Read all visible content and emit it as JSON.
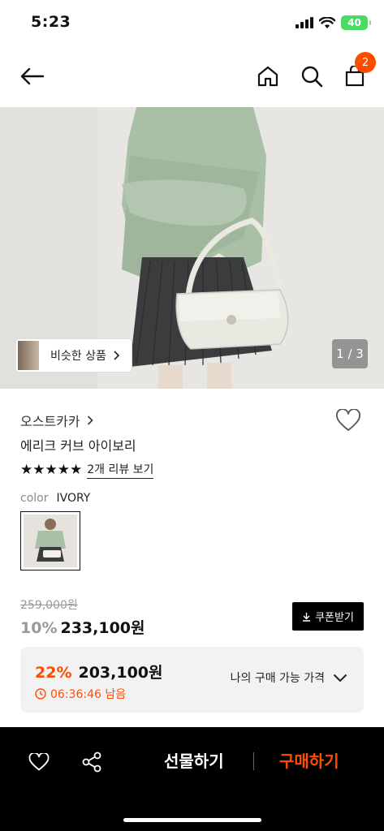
{
  "status": {
    "time": "5:23",
    "battery": "40"
  },
  "nav": {
    "cart_count": "2"
  },
  "hero": {
    "similar_label": "비슷한 상품",
    "page_counter": "1 / 3"
  },
  "product": {
    "brand": "오스트카카",
    "name": "에리크 커브 아이보리",
    "stars": "★★★★★",
    "review_link": "2개 리뷰 보기",
    "color_key": "color",
    "color_value": "IVORY"
  },
  "price": {
    "original": "259,000원",
    "discount": "10%",
    "sale": "233,100원",
    "coupon_label": "쿠폰받기"
  },
  "best": {
    "discount": "22%",
    "price": "203,100원",
    "timer": "06:36:46 남음",
    "available_label": "나의 구매 가능 가격"
  },
  "bottom": {
    "gift_label": "선물하기",
    "buy_label": "구매하기"
  },
  "colors": {
    "accent": "#ff4d00",
    "battery": "#4cd964"
  },
  "icons": [
    "back-arrow-icon",
    "home-icon",
    "search-icon",
    "shopping-bag-icon",
    "heart-icon",
    "share-icon",
    "clock-icon",
    "download-icon",
    "chevron-down-icon",
    "chevron-right-icon"
  ]
}
